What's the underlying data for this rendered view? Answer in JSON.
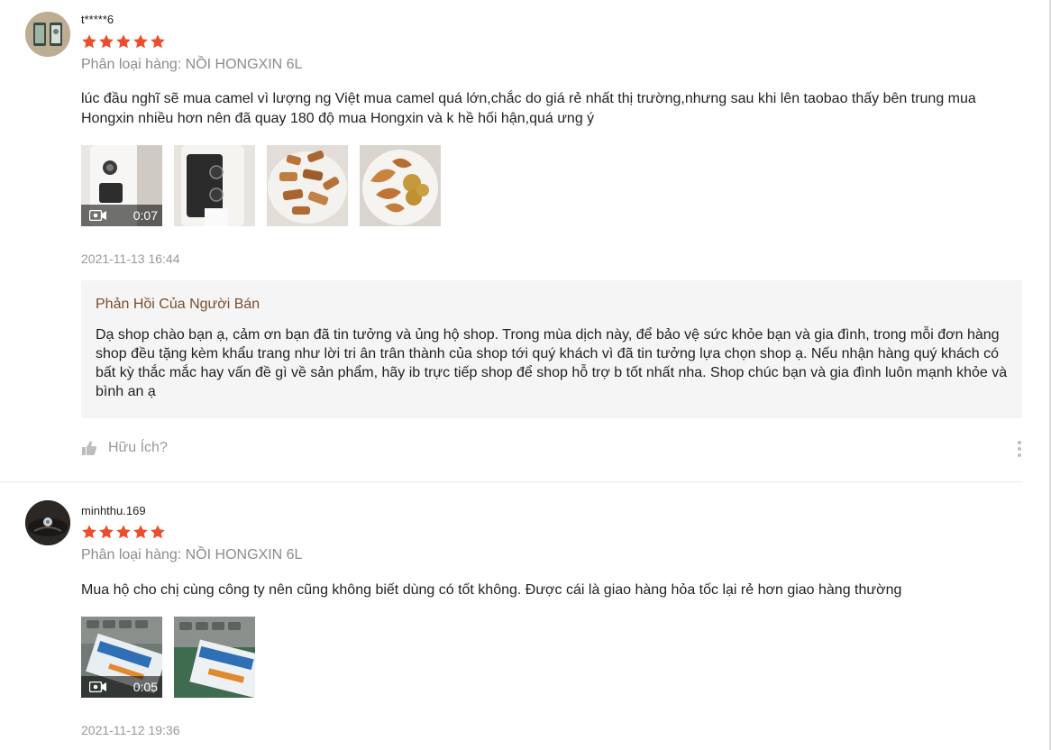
{
  "colors": {
    "star": "#ee4d2d",
    "seller_title": "#7a4e2b",
    "muted": "#999999",
    "reply_background": "#f5f5f5"
  },
  "reviews": [
    {
      "username": "t*****6",
      "rating": 5,
      "variation": "Phân loại hàng: NỒI HONGXIN 6L",
      "comment": "lúc đầu nghĩ sẽ mua camel vì lượng ng Việt mua camel quá lớn,chắc do giá rẻ nhất thị trường,nhưng sau khi lên taobao thấy bên trung mua Hongxin nhiều hơn nên đã quay 180 độ mua Hongxin và k hề hối hận,quá ưng ý",
      "media": [
        {
          "kind": "video",
          "duration": "0:07",
          "icon": "video-camera-icon"
        },
        {
          "kind": "image"
        },
        {
          "kind": "image"
        },
        {
          "kind": "image"
        }
      ],
      "timestamp": "2021-11-13 16:44",
      "seller_reply": {
        "title": "Phản Hồi Của Người Bán",
        "text": "Dạ shop chào bạn ạ, cảm ơn bạn đã tin tưởng và ủng hộ shop. Trong mùa dịch này, để bảo vệ sức khỏe bạn và gia đình, trong mỗi đơn hàng shop đều tặng kèm khẩu trang như lời tri ân trân thành của shop tới quý khách vì đã tin tưởng lựa chọn shop ạ. Nếu nhận hàng quý khách có bất kỳ thắc mắc hay vấn đề gì về sản phẩm, hãy ib trực tiếp shop để shop hỗ trợ b tốt nhất nha. Shop chúc bạn và gia đình luôn mạnh khỏe và bình an ạ"
      },
      "helpful_label": "Hữu Ích?",
      "icons": {
        "helpful": "thumbs-up-icon",
        "menu": "more-vertical-icon"
      }
    },
    {
      "username": "minhthu.169",
      "rating": 5,
      "variation": "Phân loại hàng: NỒI HONGXIN 6L",
      "comment": "Mua hộ cho chị cùng công ty nên cũng không biết dùng có tốt không. Được cái là giao hàng hỏa tốc lại rẻ hơn giao hàng thường",
      "media": [
        {
          "kind": "video",
          "duration": "0:05",
          "icon": "video-camera-icon"
        },
        {
          "kind": "image"
        }
      ],
      "timestamp": "2021-11-12 19:36"
    }
  ]
}
